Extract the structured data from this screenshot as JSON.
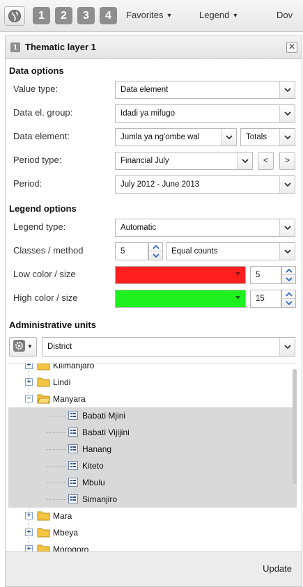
{
  "toolbar": {
    "layer_buttons": [
      "1",
      "2",
      "3",
      "4"
    ],
    "favorites_label": "Favorites",
    "legend_label": "Legend",
    "download_label": "Dov"
  },
  "panel": {
    "badge": "1",
    "title": "Thematic layer 1",
    "close_symbol": "✕"
  },
  "data_options": {
    "section_title": "Data options",
    "value_type": {
      "label": "Value type:",
      "value": "Data element"
    },
    "data_el_group": {
      "label": "Data el. group:",
      "value": "Idadi ya mifugo"
    },
    "data_element": {
      "label": "Data element:",
      "value": "Jumla ya ng'ombe wal",
      "details_value": "Totals"
    },
    "period_type": {
      "label": "Period type:",
      "value": "Financial July",
      "prev": "<",
      "next": ">"
    },
    "period": {
      "label": "Period:",
      "value": "July 2012 - June 2013"
    }
  },
  "legend_options": {
    "section_title": "Legend options",
    "legend_type": {
      "label": "Legend type:",
      "value": "Automatic"
    },
    "classes_method": {
      "label": "Classes / method",
      "classes": "5",
      "method": "Equal counts"
    },
    "low_color_size": {
      "label": "Low color / size",
      "color": "#ff1f1f",
      "size": "5"
    },
    "high_color_size": {
      "label": "High color / size",
      "color": "#1ff01f",
      "size": "15"
    }
  },
  "admin_units": {
    "section_title": "Administrative units",
    "level_value": "District",
    "tree": [
      {
        "label": "Kilimanjaro",
        "type": "folder",
        "expanded": false,
        "level": 1,
        "selected": false
      },
      {
        "label": "Lindi",
        "type": "folder",
        "expanded": false,
        "level": 1,
        "selected": false
      },
      {
        "label": "Manyara",
        "type": "folder",
        "expanded": true,
        "level": 1,
        "selected": false
      },
      {
        "label": "Babati Mjini",
        "type": "leaf",
        "level": 2,
        "selected": true
      },
      {
        "label": "Babati Vijijini",
        "type": "leaf",
        "level": 2,
        "selected": true
      },
      {
        "label": "Hanang",
        "type": "leaf",
        "level": 2,
        "selected": true
      },
      {
        "label": "Kiteto",
        "type": "leaf",
        "level": 2,
        "selected": true
      },
      {
        "label": "Mbulu",
        "type": "leaf",
        "level": 2,
        "selected": true
      },
      {
        "label": "Simanjiro",
        "type": "leaf",
        "level": 2,
        "selected": true
      },
      {
        "label": "Mara",
        "type": "folder",
        "expanded": false,
        "level": 1,
        "selected": false
      },
      {
        "label": "Mbeya",
        "type": "folder",
        "expanded": false,
        "level": 1,
        "selected": false
      },
      {
        "label": "Morogoro",
        "type": "folder",
        "expanded": false,
        "level": 1,
        "selected": false
      }
    ]
  },
  "footer": {
    "update_label": "Update"
  },
  "colors": {
    "accent_gray": "#8e8e8e",
    "selection": "#d9d9d9",
    "folder": "#f4c542"
  }
}
